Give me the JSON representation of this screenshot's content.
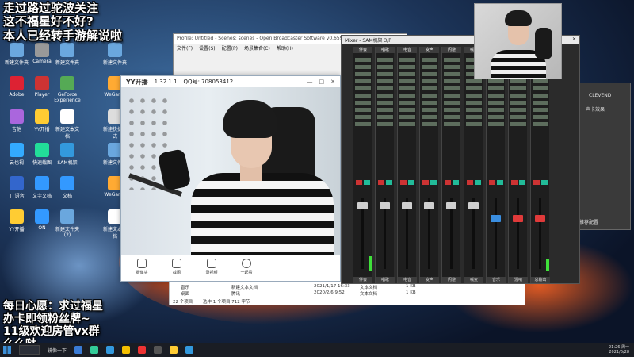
{
  "overlay_top": {
    "line1": "走过路过驼波关注",
    "line2": "这不福星好不好?",
    "line3": "本人已经转手游解说啦"
  },
  "overlay_bottom": {
    "line1": "每日心愿：求过福星",
    "line2": "办卡即领粉丝牌~",
    "line3": "11级欢迎房管vx群",
    "line4": "么么哒"
  },
  "desktop": {
    "icons": [
      {
        "label": "新建文件夹",
        "color": "#6aa7de"
      },
      {
        "label": "Camera",
        "color": "#999"
      },
      {
        "label": "新建文件夹",
        "color": "#6aa7de"
      },
      {
        "label": "新建文件夹",
        "color": "#6aa7de"
      },
      {
        "label": "Adobe",
        "color": "#d23"
      },
      {
        "label": "Player",
        "color": "#c33"
      },
      {
        "label": "GeForce Experience",
        "color": "#5a5"
      },
      {
        "label": "WeGame",
        "color": "#fa3"
      },
      {
        "label": "吉他",
        "color": "#a6d"
      },
      {
        "label": "YY开播",
        "color": "#fc3"
      },
      {
        "label": "新建文本文档",
        "color": "#fff"
      },
      {
        "label": "新建快捷方式",
        "color": "#ddd"
      },
      {
        "label": "云也视",
        "color": "#3af"
      },
      {
        "label": "快速截图",
        "color": "#2d9"
      },
      {
        "label": "SAM机架",
        "color": "#39d"
      },
      {
        "label": "新建文件夹",
        "color": "#6aa7de"
      },
      {
        "label": "TT语音",
        "color": "#36c"
      },
      {
        "label": "文字文档",
        "color": "#39f"
      },
      {
        "label": "文档",
        "color": "#39f"
      },
      {
        "label": "WeGame",
        "color": "#fa3"
      },
      {
        "label": "YY开播",
        "color": "#fc3"
      },
      {
        "label": "ON",
        "color": "#39f"
      },
      {
        "label": "新建文件夹 (2)",
        "color": "#6aa7de"
      },
      {
        "label": "新建文本文档",
        "color": "#fff"
      }
    ]
  },
  "obs": {
    "title": "Profile: Untitled - Scenes: scenes - Open Broadcaster Software v0.659b",
    "menu": [
      "文件(F)",
      "设置(S)",
      "配置(P)",
      "场景集合(C)",
      "帮助(H)"
    ]
  },
  "yy": {
    "brand": "YY开播",
    "version": "1.32.1.1",
    "qq": "QQ号: 708053412",
    "tools": [
      "摄像头",
      "截图",
      "录视频",
      "一起看"
    ],
    "minimize": "—",
    "maximize": "□",
    "close": "✕"
  },
  "explorer": {
    "sidebar": [
      "音乐",
      "桌面"
    ],
    "status": "22 个项目",
    "selected": "选中 1 个项目  712 字节",
    "files": [
      {
        "name": "新建文本文档",
        "date": "2021/1/17 16:33",
        "type": "文本文档",
        "size": "1 KB"
      },
      {
        "name": "腾讯",
        "date": "2020/2/6 9:52",
        "type": "文本文档",
        "size": "1 KB"
      }
    ]
  },
  "mixer": {
    "title": "Mixer - SAM机架 3/P",
    "close": "✕",
    "channels": [
      {
        "name": "伴奏",
        "bottom": "伴奏",
        "knob": "grey",
        "meter": 18
      },
      {
        "name": "唱歌",
        "bottom": "唱歌",
        "knob": "grey",
        "meter": 0
      },
      {
        "name": "电音",
        "bottom": "电音",
        "knob": "grey",
        "meter": 0
      },
      {
        "name": "变声",
        "bottom": "变声",
        "knob": "grey",
        "meter": 0
      },
      {
        "name": "闪避",
        "bottom": "闪避",
        "knob": "grey",
        "meter": 0
      },
      {
        "name": "喊麦",
        "bottom": "喊麦",
        "knob": "grey",
        "meter": 0
      },
      {
        "name": "音乐",
        "bottom": "音乐",
        "knob": "blue",
        "meter": 0
      },
      {
        "name": "混响",
        "bottom": "混响",
        "knob": "red",
        "meter": 0
      },
      {
        "name": "总线",
        "bottom": "总输出",
        "knob": "red",
        "meter": 14
      }
    ]
  },
  "rightpanel": {
    "labels": [
      "CLEVEND",
      "声卡效果",
      "效果",
      "推荐配置"
    ]
  },
  "taskbar": {
    "time": "21:26 周一",
    "date": "2021/6/28",
    "app_label": "镜像一下"
  }
}
